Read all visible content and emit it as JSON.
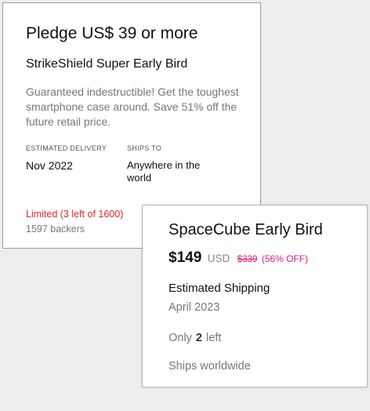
{
  "reward_card": {
    "pledge": "Pledge US$ 39 or more",
    "title": "StrikeShield Super Early Bird",
    "description": "Guaranteed indestructible! Get the toughest smartphone case around. Save 51% off the future retail price.",
    "estimated_delivery_label": "ESTIMATED DELIVERY",
    "estimated_delivery_value": "Nov 2022",
    "ships_to_label": "SHIPS TO",
    "ships_to_value": "Anywhere in the world",
    "limited": "Limited (3 left of 1600)",
    "backers": "1597 backers",
    "colors": {
      "limited": "#e3262b",
      "muted": "#777777"
    }
  },
  "perk_card": {
    "title": "SpaceCube Early Bird",
    "price": "$149",
    "currency": "USD",
    "original_price": "$339",
    "discount": "(56% OFF)",
    "shipping_label": "Estimated Shipping",
    "shipping_date": "April 2023",
    "only_prefix": "Only",
    "only_count": "2",
    "only_suffix": "left",
    "ships_worldwide": "Ships worldwide",
    "colors": {
      "discount": "#e1197a"
    }
  }
}
